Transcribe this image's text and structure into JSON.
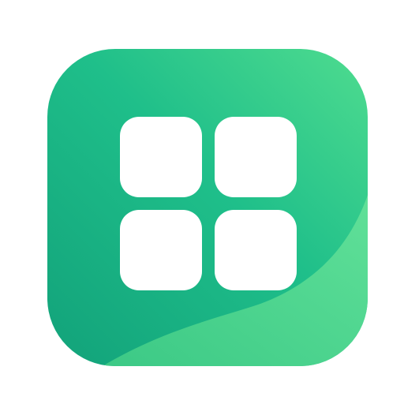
{
  "icon": {
    "name": "app-grid-icon",
    "colors": {
      "gradient_start": "#12a27a",
      "gradient_mid": "#1fbf8a",
      "gradient_end": "#4fdc8f",
      "wave_start": "#3fcc86",
      "wave_end": "#67e39a",
      "tile": "#ffffff"
    }
  }
}
